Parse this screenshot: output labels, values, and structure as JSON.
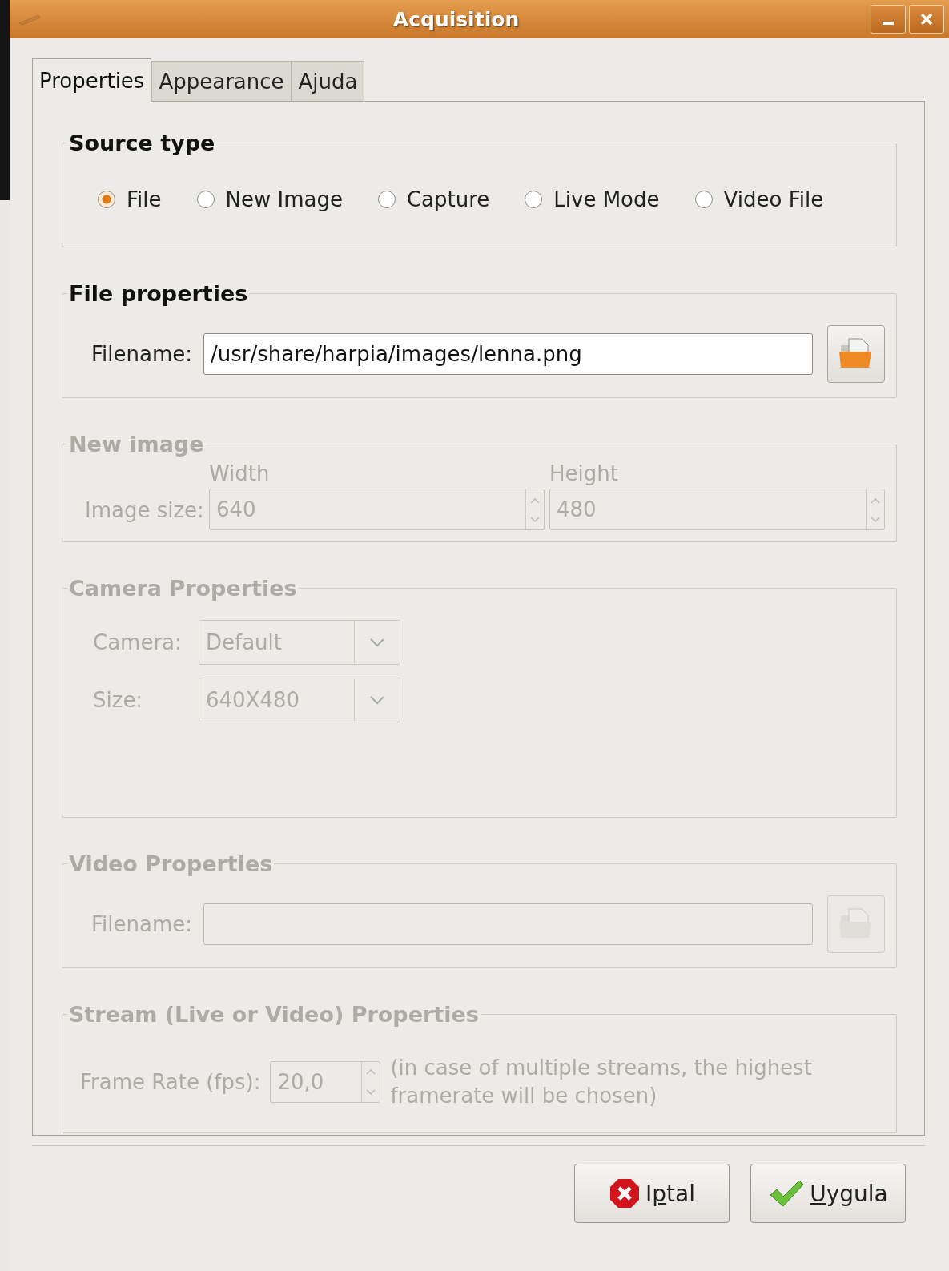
{
  "window": {
    "title": "Acquisition"
  },
  "tabs": [
    {
      "label": "Properties",
      "selected": true
    },
    {
      "label": "Appearance",
      "selected": false
    },
    {
      "label": "Ajuda",
      "selected": false
    }
  ],
  "sections": [
    {
      "kind": "radios",
      "title": "Source type",
      "disabled": false,
      "options": [
        {
          "label": "File",
          "selected": true
        },
        {
          "label": "New Image",
          "selected": false
        },
        {
          "label": "Capture",
          "selected": false
        },
        {
          "label": "Live Mode",
          "selected": false
        },
        {
          "label": "Video File",
          "selected": false
        }
      ]
    },
    {
      "kind": "file",
      "title": "File properties",
      "disabled": false,
      "label": "Filename:",
      "value": "/usr/share/harpia/images/lenna.png"
    },
    {
      "kind": "size",
      "title": "New image",
      "disabled": true,
      "label": "Image size:",
      "fields": [
        {
          "caption": "Width",
          "value": "640"
        },
        {
          "caption": "Height",
          "value": "480"
        }
      ]
    },
    {
      "kind": "combos",
      "title": "Camera Properties",
      "disabled": true,
      "rows": [
        {
          "label": "Camera:",
          "value": "Default"
        },
        {
          "label": "Size:",
          "value": "640X480"
        }
      ]
    },
    {
      "kind": "file",
      "title": "Video Properties",
      "disabled": true,
      "label": "Filename:"
    },
    {
      "kind": "rate",
      "title": "Stream (Live or Video) Properties",
      "disabled": true,
      "label": "Frame Rate (fps):",
      "value": "20,0",
      "note": "(in case of multiple streams, the highest framerate will be chosen)"
    }
  ],
  "buttons": [
    {
      "kind": "cancel",
      "before": "I",
      "access_key": "p",
      "after": "tal"
    },
    {
      "kind": "apply",
      "access_key": "U",
      "after": "ygula"
    }
  ]
}
